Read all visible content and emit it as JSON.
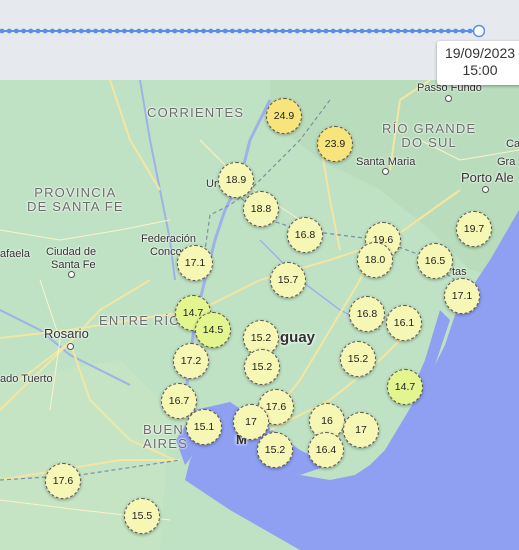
{
  "timeline": {
    "position_fraction": 1.0,
    "label_date": "19/09/2023",
    "label_time": "15:00"
  },
  "colors": {
    "land": "#bfe2c4",
    "water": "#8f9ff2",
    "road": "#f3e6a2",
    "border": "#7e8ea6"
  },
  "labels": {
    "corrientes": "CORRIENTES",
    "rio_grande_1": "RÍO GRANDE",
    "rio_grande_2": "DO SUL",
    "provincia_1": "PROVINCIA",
    "provincia_2": "DE SANTA FE",
    "entre_rios": "ENTRE RÍO",
    "buenos_1": "BUEN",
    "buenos_2": "AIRES",
    "passo_fundo": "Passo Fundo",
    "santa_maria": "Santa Maria",
    "porto_alegre": "Porto Ale",
    "gra": "Gra",
    "ca": "Ca",
    "uruguaiana": "Ur",
    "federacion_1": "Federación",
    "federacion_2": "Concordia",
    "rafaela": "afaela",
    "ciudad_1": "Ciudad de",
    "ciudad_2": "Santa Fe",
    "rosario": "Rosario",
    "tuerto": "ado Tuerto",
    "uruguay": "guay",
    "tas": "tas",
    "mo": "M"
  },
  "stations": [
    {
      "value": "24.9",
      "color": "#f7e47a"
    },
    {
      "value": "23.9",
      "color": "#f7e47a"
    },
    {
      "value": "18.9",
      "color": "#f7f7b5"
    },
    {
      "value": "18.8",
      "color": "#f7f7b5"
    },
    {
      "value": "16.8",
      "color": "#f7f7b5"
    },
    {
      "value": "19.6",
      "color": "#f7f7b5"
    },
    {
      "value": "19.7",
      "color": "#f7f7b5"
    },
    {
      "value": "18.0",
      "color": "#f7f7b5"
    },
    {
      "value": "16.5",
      "color": "#f7f7b5"
    },
    {
      "value": "17.1",
      "color": "#f7f7b5"
    },
    {
      "value": "15.7",
      "color": "#f7f7b5"
    },
    {
      "value": "17.1",
      "color": "#f7f7b5"
    },
    {
      "value": "14.7",
      "color": "#e2f58e"
    },
    {
      "value": "14.5",
      "color": "#e2f58e"
    },
    {
      "value": "15.2",
      "color": "#f7f7b5"
    },
    {
      "value": "16.8",
      "color": "#f7f7b5"
    },
    {
      "value": "16.1",
      "color": "#f7f7b5"
    },
    {
      "value": "17.2",
      "color": "#f7f7b5"
    },
    {
      "value": "15.2",
      "color": "#f7f7b5"
    },
    {
      "value": "15.2",
      "color": "#f7f7b5"
    },
    {
      "value": "14.7",
      "color": "#e2f58e"
    },
    {
      "value": "16.7",
      "color": "#f7f7b5"
    },
    {
      "value": "17.6",
      "color": "#f7f7b5"
    },
    {
      "value": "15.1",
      "color": "#f7f7b5"
    },
    {
      "value": "17",
      "color": "#f7f7b5"
    },
    {
      "value": "16",
      "color": "#f7f7b5"
    },
    {
      "value": "17",
      "color": "#f7f7b5"
    },
    {
      "value": "15.2",
      "color": "#f7f7b5"
    },
    {
      "value": "16.4",
      "color": "#f7f7b5"
    },
    {
      "value": "17.6",
      "color": "#f7f7b5"
    },
    {
      "value": "15.5",
      "color": "#f7f7b5"
    }
  ]
}
